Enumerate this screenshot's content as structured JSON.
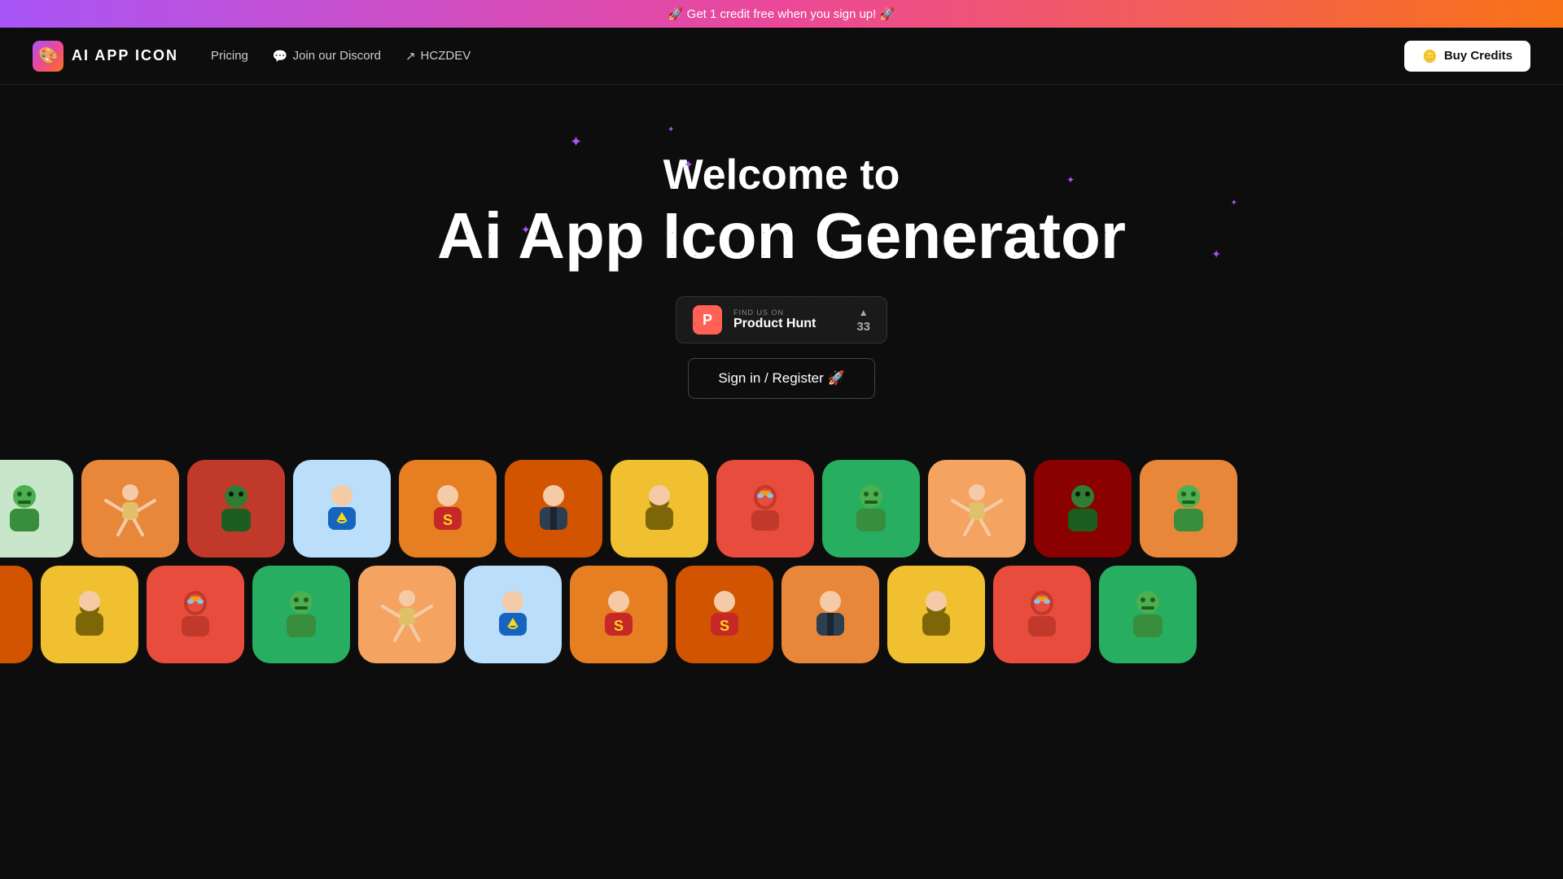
{
  "banner": {
    "text": "🚀 Get 1 credit free when you sign up! 🚀"
  },
  "nav": {
    "logo_text": "AI APP ICON",
    "pricing_label": "Pricing",
    "discord_label": "Join our Discord",
    "hczdev_label": "HCZDEV",
    "buy_credits_label": "Buy Credits"
  },
  "hero": {
    "line1": "Welcome to",
    "line2": "Ai App Icon Generator",
    "ph_find": "FIND US ON",
    "ph_name": "Product Hunt",
    "ph_count": "33",
    "signin_label": "Sign in / Register 🚀"
  },
  "icons": {
    "row1": [
      {
        "theme": "green-light",
        "char": "hulk"
      },
      {
        "theme": "orange",
        "char": "yoga"
      },
      {
        "theme": "red",
        "char": "hulk-dark"
      },
      {
        "theme": "blue-light",
        "char": "superman"
      },
      {
        "theme": "orange2",
        "char": "superman-s"
      },
      {
        "theme": "orange3",
        "char": "man-shirt"
      },
      {
        "theme": "gold",
        "char": "man-beard"
      },
      {
        "theme": "red2",
        "char": "ironman"
      },
      {
        "theme": "green2",
        "char": "hulk"
      },
      {
        "theme": "peach",
        "char": "yoga"
      },
      {
        "theme": "dark-red",
        "char": "hulk-dark"
      },
      {
        "theme": "orange",
        "char": "hulk"
      }
    ],
    "row2": [
      {
        "theme": "orange3",
        "char": "man-shirt"
      },
      {
        "theme": "gold",
        "char": "man-beard"
      },
      {
        "theme": "red2",
        "char": "ironman"
      },
      {
        "theme": "green2",
        "char": "hulk"
      },
      {
        "theme": "peach",
        "char": "yoga"
      },
      {
        "theme": "blue-light",
        "char": "superman"
      },
      {
        "theme": "orange2",
        "char": "superman-s"
      },
      {
        "theme": "orange3",
        "char": "superman-s2"
      },
      {
        "theme": "orange",
        "char": "man-shirt"
      },
      {
        "theme": "gold",
        "char": "man-beard"
      },
      {
        "theme": "red2",
        "char": "ironman"
      },
      {
        "theme": "green2",
        "char": "hulk"
      }
    ]
  }
}
